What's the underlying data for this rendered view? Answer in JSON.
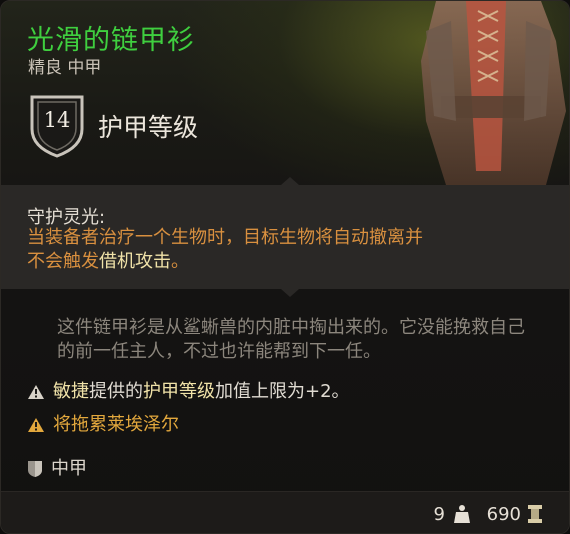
{
  "item": {
    "name": "光滑的链甲衫",
    "subtitle": "精良 中甲",
    "icon": "chain-shirt-armor-image"
  },
  "armor_class": {
    "value": "14",
    "label": "护甲等级",
    "icon": "shield-icon"
  },
  "passive": {
    "title": "守护灵光:",
    "desc_part1": "当装备者治疗一个生物时，目标生物将自动撤离并",
    "desc_part2": "不会触发",
    "desc_keyword": "借机攻击",
    "desc_part3": "。"
  },
  "flavor_text": "这件链甲衫是从鲨蜥兽的内脏中掏出来的。它没能挽救自己的前一任主人，不过也许能帮到下一任。",
  "properties": {
    "dex_kw1": "敏捷",
    "dex_mid": "提供的",
    "dex_kw2": "护甲等级",
    "dex_tail": "加值上限为+2。",
    "dex_icon": "warning-icon",
    "karlach_text": "将拖累莱埃泽尔",
    "karlach_icon": "warning-orange-icon",
    "armor_type": "中甲",
    "armor_type_icon": "medium-armor-icon"
  },
  "footer": {
    "weight": "9",
    "weight_icon": "weight-icon",
    "price": "690",
    "price_icon": "gold-coin-icon"
  },
  "colors": {
    "rarity_green": "#3fcf3f",
    "passive_orange": "#d9903f",
    "keyword": "#f0e2a8",
    "warning_orange": "#e3a83d"
  }
}
